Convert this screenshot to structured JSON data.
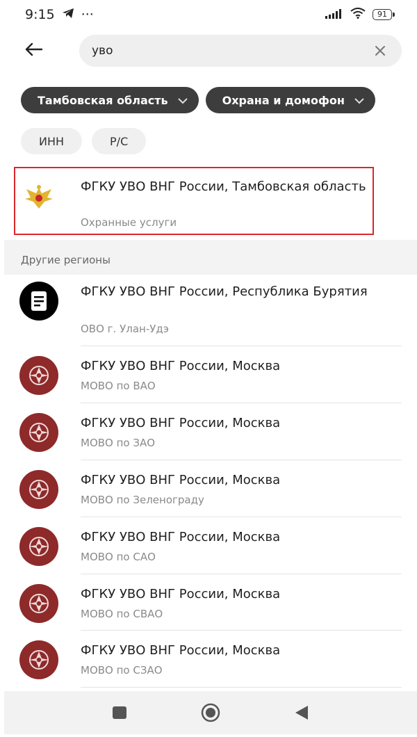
{
  "status_bar": {
    "time": "9:15",
    "dots": "···",
    "battery": "91"
  },
  "search": {
    "query": "уво"
  },
  "filters": [
    {
      "label": "Тамбовская область"
    },
    {
      "label": "Охрана и домофон"
    }
  ],
  "chips": [
    {
      "label": "ИНН"
    },
    {
      "label": "Р/С"
    }
  ],
  "top_result": {
    "title": "ФГКУ УВО ВНГ России, Тамбовская область",
    "subtitle": "Охранные услуги",
    "logo": "eagle-emblem"
  },
  "section_title": "Другие регионы",
  "results": [
    {
      "title": "ФГКУ УВО ВНГ России, Республика Бурятия",
      "subtitle": "ОВО г. Улан-Удэ",
      "logo": "document-icon"
    },
    {
      "title": "ФГКУ УВО ВНГ России, Москва",
      "subtitle": "МОВО по ВАО",
      "logo": "emblem"
    },
    {
      "title": "ФГКУ УВО ВНГ России, Москва",
      "subtitle": "МОВО по ЗАО",
      "logo": "emblem"
    },
    {
      "title": "ФГКУ УВО ВНГ России, Москва",
      "subtitle": "МОВО по Зеленограду",
      "logo": "emblem"
    },
    {
      "title": "ФГКУ УВО ВНГ России, Москва",
      "subtitle": "МОВО по САО",
      "logo": "emblem"
    },
    {
      "title": "ФГКУ УВО ВНГ России, Москва",
      "subtitle": "МОВО по СВАО",
      "logo": "emblem"
    },
    {
      "title": "ФГКУ УВО ВНГ России, Москва",
      "subtitle": "МОВО по СЗАО",
      "logo": "emblem"
    }
  ],
  "colors": {
    "chip_dark": "#3d3d3d",
    "highlight": "#d9262b",
    "emblem": "#8e2a2a"
  }
}
